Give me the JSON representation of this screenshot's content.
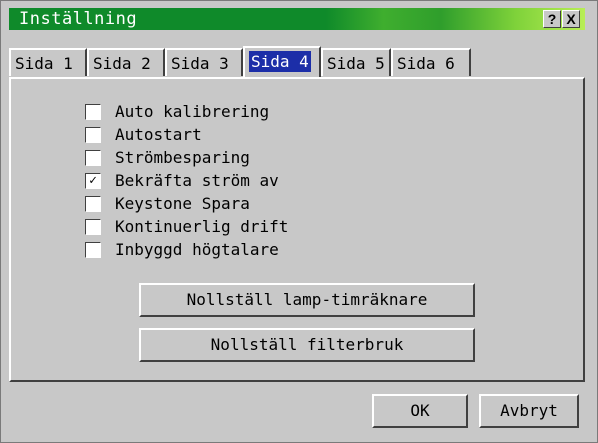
{
  "window": {
    "title": "Inställning",
    "help_label": "?",
    "close_label": "X"
  },
  "tabs": [
    {
      "label": "Sida 1",
      "selected": false
    },
    {
      "label": "Sida 2",
      "selected": false
    },
    {
      "label": "Sida 3",
      "selected": false
    },
    {
      "label": "Sida 4",
      "selected": true
    },
    {
      "label": "Sida 5",
      "selected": false
    },
    {
      "label": "Sida 6",
      "selected": false
    }
  ],
  "options": [
    {
      "label": "Auto kalibrering",
      "checked": false
    },
    {
      "label": "Autostart",
      "checked": false
    },
    {
      "label": "Strömbesparing",
      "checked": false
    },
    {
      "label": "Bekräfta ström av",
      "checked": true
    },
    {
      "label": "Keystone Spara",
      "checked": false
    },
    {
      "label": "Kontinuerlig drift",
      "checked": false
    },
    {
      "label": "Inbyggd högtalare",
      "checked": false
    }
  ],
  "actions": {
    "reset_lamp_label": "Nollställ lamp-timräknare",
    "reset_filter_label": "Nollställ filterbruk"
  },
  "footer": {
    "ok_label": "OK",
    "cancel_label": "Avbryt"
  },
  "colors": {
    "titlebar": "#0f8a2a",
    "selected_tab": "#1c2ea8",
    "face": "#c8c8c8"
  }
}
